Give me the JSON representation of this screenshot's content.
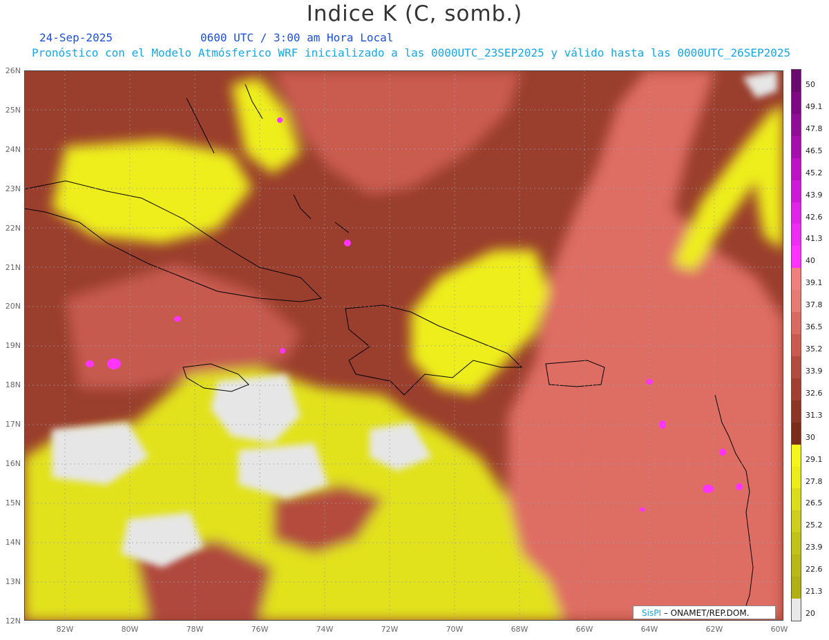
{
  "header": {
    "title": "Indice K (C, somb.)",
    "date": "24-Sep-2025",
    "time": "0600 UTC / 3:00 am Hora Local",
    "forecast": "Pronóstico con el Modelo Atmósferico WRF inicializado a las 0000UTC_23SEP2025 y válido hasta las  0000UTC_26SEP2025"
  },
  "map": {
    "lat_labels": [
      "26N",
      "25N",
      "24N",
      "23N",
      "22N",
      "21N",
      "20N",
      "19N",
      "18N",
      "17N",
      "16N",
      "15N",
      "14N",
      "13N",
      "12N"
    ],
    "lon_labels": [
      "82W",
      "80W",
      "78W",
      "76W",
      "74W",
      "72W",
      "70W",
      "68W",
      "66W",
      "64W",
      "62W",
      "60W"
    ],
    "lat_range": [
      12,
      26
    ],
    "lon_range": [
      -83.3,
      -60.0
    ],
    "gridlines": true,
    "coastline_color": "#000000"
  },
  "colorbar": {
    "labels": [
      "50",
      "49.1",
      "47.8",
      "46.5",
      "45.2",
      "43.9",
      "42.6",
      "41.3",
      "40",
      "39.1",
      "37.8",
      "36.5",
      "35.2",
      "33.9",
      "32.6",
      "31.3",
      "30",
      "29.1",
      "27.8",
      "26.5",
      "25.2",
      "23.9",
      "22.6",
      "21.3",
      "20"
    ],
    "colors": [
      "#6b0a6e",
      "#7d0a82",
      "#8f0c96",
      "#a50fae",
      "#bb12c4",
      "#cc1ad6",
      "#de24e6",
      "#ee2df2",
      "#ff33ff",
      "#f0807e",
      "#e57b75",
      "#d86a62",
      "#c85a50",
      "#b34c40",
      "#9f4032",
      "#8c3626",
      "#7a2d1a",
      "#f5f51e",
      "#ebeb1e",
      "#dcdc1e",
      "#cece1e",
      "#c2c21a",
      "#b8b818",
      "#b0b016",
      "#e8e8e8"
    ]
  },
  "credit": {
    "logo": "SisPI",
    "org": "– ONAMET/REP.DOM."
  }
}
